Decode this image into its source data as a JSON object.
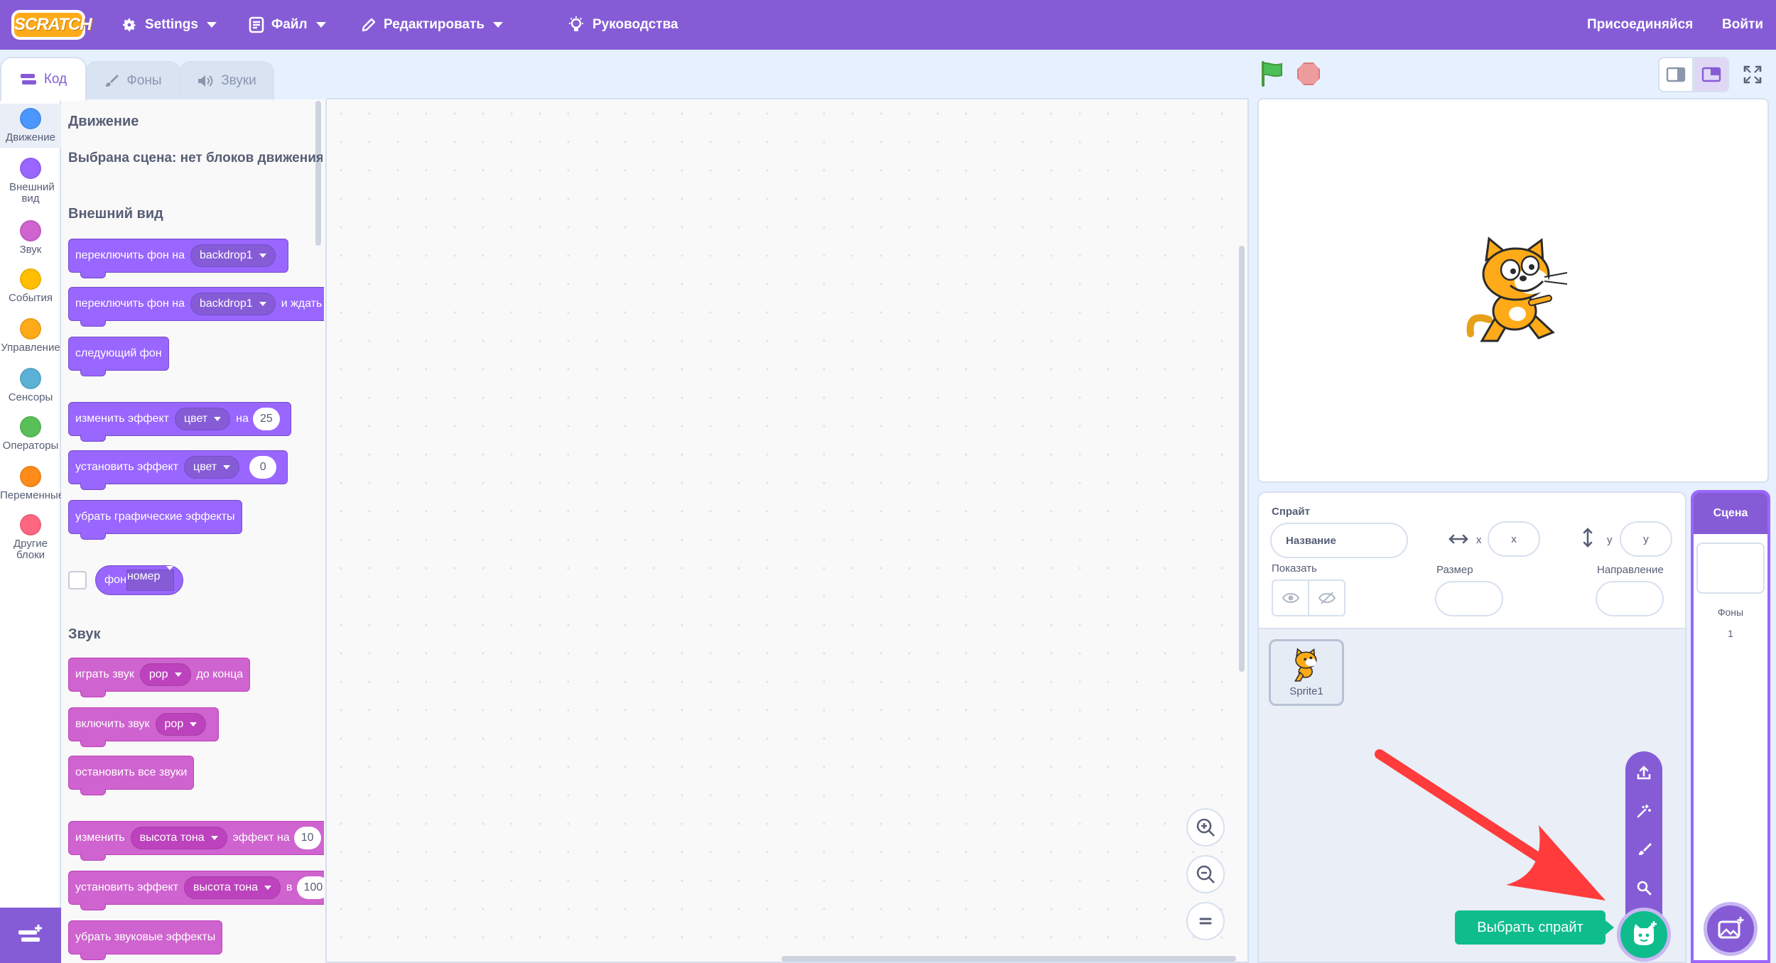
{
  "menubar": {
    "logo": "SCRATCH",
    "settings": "Settings",
    "file": "Файл",
    "edit": "Редактировать",
    "tutorials": "Руководства",
    "join": "Присоединяйся",
    "signin": "Войти",
    "bg_color": "#855cd6"
  },
  "tabs": {
    "code": "Код",
    "backdrops": "Фоны",
    "sounds": "Звуки"
  },
  "categories": [
    {
      "label": "Движение",
      "color": "#4c97ff"
    },
    {
      "label": "Внешний вид",
      "color": "#9966ff"
    },
    {
      "label": "Звук",
      "color": "#cf63cf"
    },
    {
      "label": "События",
      "color": "#ffbf00"
    },
    {
      "label": "Управление",
      "color": "#ffab19"
    },
    {
      "label": "Сенсоры",
      "color": "#5cb1d6"
    },
    {
      "label": "Операторы",
      "color": "#59c059"
    },
    {
      "label": "Переменные",
      "color": "#ff8c1a"
    },
    {
      "label": "Другие блоки",
      "color": "#ff6680"
    }
  ],
  "flyout": {
    "motion_heading": "Движение",
    "motion_note": "Выбрана сцена: нет блоков движения",
    "looks_heading": "Внешний вид",
    "sound_heading": "Звук",
    "looks_blocks": {
      "switch_backdrop": "переключить фон на",
      "switch_backdrop_value": "backdrop1",
      "switch_backdrop_wait": "переключить фон на",
      "switch_backdrop_wait_value": "backdrop1",
      "switch_backdrop_wait_suffix": "и ждать",
      "next_backdrop": "следующий фон",
      "change_effect": "изменить эффект",
      "change_effect_value": "цвет",
      "change_effect_by": "на",
      "change_effect_num": "25",
      "set_effect": "установить эффект",
      "set_effect_value": "цвет",
      "set_effect_num": "0",
      "clear_effects": "убрать графические эффекты",
      "backdrop_reporter": "фон",
      "backdrop_reporter_value": "номер"
    },
    "sound_blocks": {
      "play_until_done": "играть звук",
      "play_until_done_value": "pop",
      "play_until_done_suffix": "до конца",
      "start_sound": "включить звук",
      "start_sound_value": "pop",
      "stop_all": "остановить все звуки",
      "change_effect": "изменить",
      "change_effect_value": "высота тона",
      "change_effect_suffix": "эффект на",
      "change_effect_num": "10",
      "set_effect": "установить эффект",
      "set_effect_value": "высота тона",
      "set_effect_to": "в",
      "set_effect_num": "100",
      "clear_effects": "убрать звуковые эффекты"
    }
  },
  "sprite_info": {
    "sprite_label": "Спрайт",
    "name_placeholder": "Название",
    "x_label": "x",
    "x_placeholder": "x",
    "y_label": "y",
    "y_placeholder": "y",
    "show_label": "Показать",
    "size_label": "Размер",
    "direction_label": "Направление"
  },
  "sprites": [
    {
      "name": "Sprite1"
    }
  ],
  "stage_target": {
    "label": "Сцена",
    "backdrops_label": "Фоны",
    "backdrops_count": "1"
  },
  "choose_sprite_tooltip": "Выбрать спрайт",
  "colors": {
    "accent": "#855cd6",
    "looks": "#9966ff",
    "sound": "#cf63cf",
    "green_button": "#0fbd8c",
    "arrow": "#ff3b3b"
  }
}
